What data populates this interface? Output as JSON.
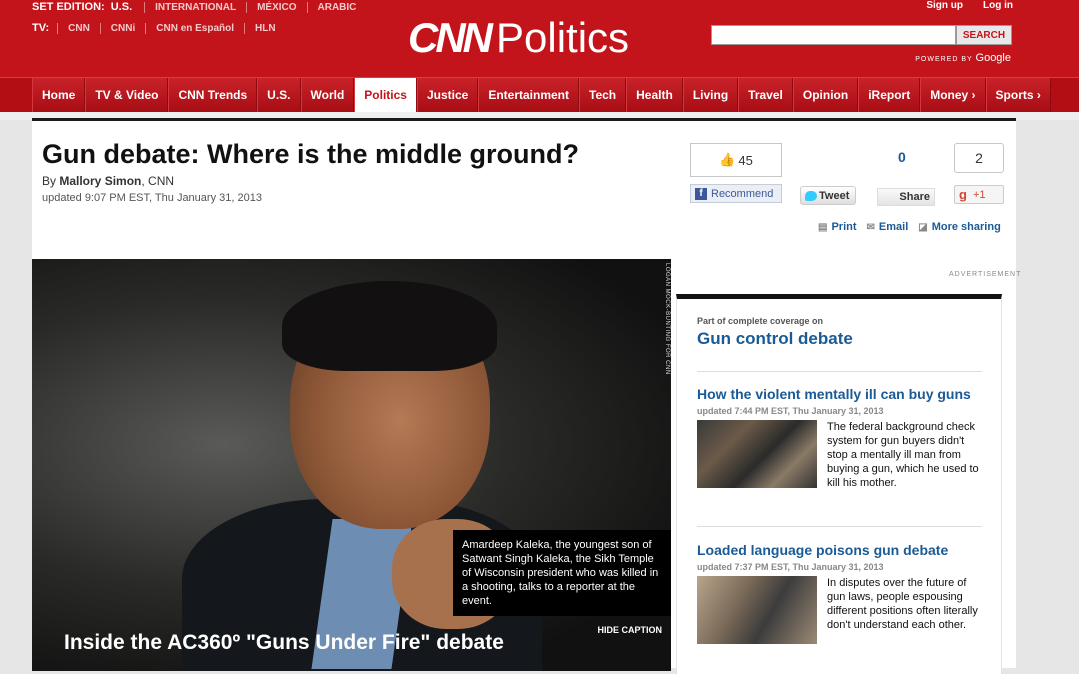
{
  "header": {
    "edition_label": "SET EDITION:",
    "edition_current": "U.S.",
    "edition_links": [
      "INTERNATIONAL",
      "MÉXICO",
      "ARABIC"
    ],
    "tv_label": "TV:",
    "tv_links": [
      "CNN",
      "CNNi",
      "CNN en Español",
      "HLN"
    ],
    "logo_cnn": "CNN",
    "logo_section": "Politics",
    "signup": "Sign up",
    "login": "Log in",
    "search_button": "SEARCH",
    "search_value": "",
    "powered_by": "POWERED BY",
    "google": "Google"
  },
  "nav": {
    "items": [
      "Home",
      "TV & Video",
      "CNN Trends",
      "U.S.",
      "World",
      "Politics",
      "Justice",
      "Entertainment",
      "Tech",
      "Health",
      "Living",
      "Travel",
      "Opinion",
      "iReport",
      "Money ›",
      "Sports ›"
    ],
    "active": "Politics"
  },
  "article": {
    "headline": "Gun debate: Where is the middle ground?",
    "by": "By ",
    "author": "Mallory Simon",
    "source": ", CNN",
    "updated": "updated 9:07 PM EST, Thu January 31, 2013"
  },
  "social": {
    "fb_count": "45",
    "fb_label": "Recommend",
    "tw_count": "0",
    "tw_label": "Tweet",
    "share_label": "Share",
    "gplus_count": "2",
    "gplus_label": "+1",
    "print": "Print",
    "email": "Email",
    "more_sharing": "More sharing"
  },
  "advertisement": "ADVERTISEMENT",
  "hero": {
    "credit": "LOGAN MOCK-BUNTING FOR CNN",
    "caption": "Amardeep Kaleka, the youngest son of Satwant Singh Kaleka, the Sikh Temple of Wisconsin president who was killed in a shooting, talks to a reporter at the event.",
    "hide_caption": "HIDE CAPTION",
    "title": "Inside the AC360º \"Guns Under Fire\" debate"
  },
  "rail": {
    "kicker": "Part of complete coverage on",
    "topic": "Gun control debate",
    "stories": [
      {
        "title": "How the violent mentally ill can buy guns",
        "date": "updated 7:44 PM EST, Thu January 31, 2013",
        "summary": "The federal background check system for gun buyers didn't stop a mentally ill man from buying a gun, which he used to kill his mother."
      },
      {
        "title": "Loaded language poisons gun debate",
        "date": "updated 7:37 PM EST, Thu January 31, 2013",
        "summary": "In disputes over the future of gun laws, people espousing different positions often literally don't understand each other."
      }
    ]
  }
}
